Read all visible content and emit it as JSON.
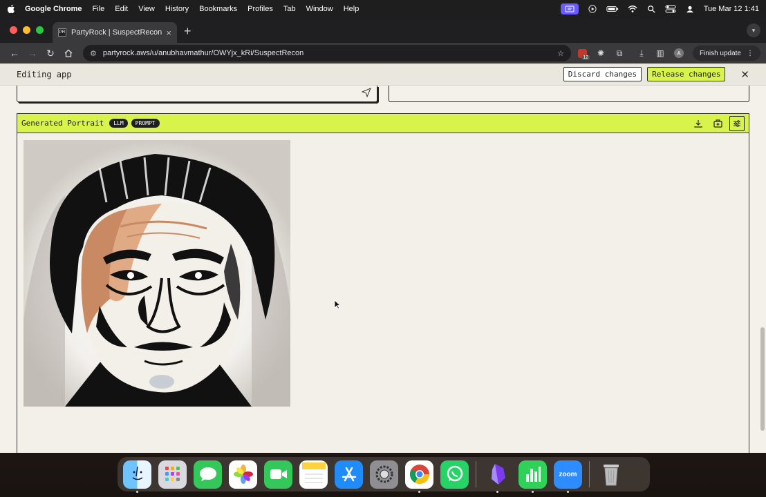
{
  "menubar": {
    "app_name": "Google Chrome",
    "items": [
      "File",
      "Edit",
      "View",
      "History",
      "Bookmarks",
      "Profiles",
      "Tab",
      "Window",
      "Help"
    ],
    "clock": "Tue Mar 12  1:41"
  },
  "browser": {
    "tab_title": "PartyRock | SuspectRecon",
    "tab_favicon": "PR",
    "url": "partyrock.aws/u/anubhavmathur/OWYjx_kRi/SuspectRecon",
    "finish_update_label": "Finish update",
    "profile_initial": "A",
    "extension_badge": "12"
  },
  "app_header": {
    "title": "Editing app",
    "discard_label": "Discard changes",
    "release_label": "Release changes",
    "accent_color": "#d8f34a"
  },
  "portrait_card": {
    "title": "Generated Portrait",
    "badges": [
      "LLM",
      "PROMPT"
    ],
    "image_alt": "Stylized comic-style portrait of a man"
  },
  "dock": {
    "apps": [
      "Finder",
      "Launchpad",
      "Messages",
      "Photos",
      "FaceTime",
      "Notes",
      "App Store",
      "System Settings",
      "Chrome",
      "WhatsApp",
      "Obsidian",
      "Numbers",
      "Zoom",
      "Trash"
    ],
    "zoom_label": "zoom"
  }
}
